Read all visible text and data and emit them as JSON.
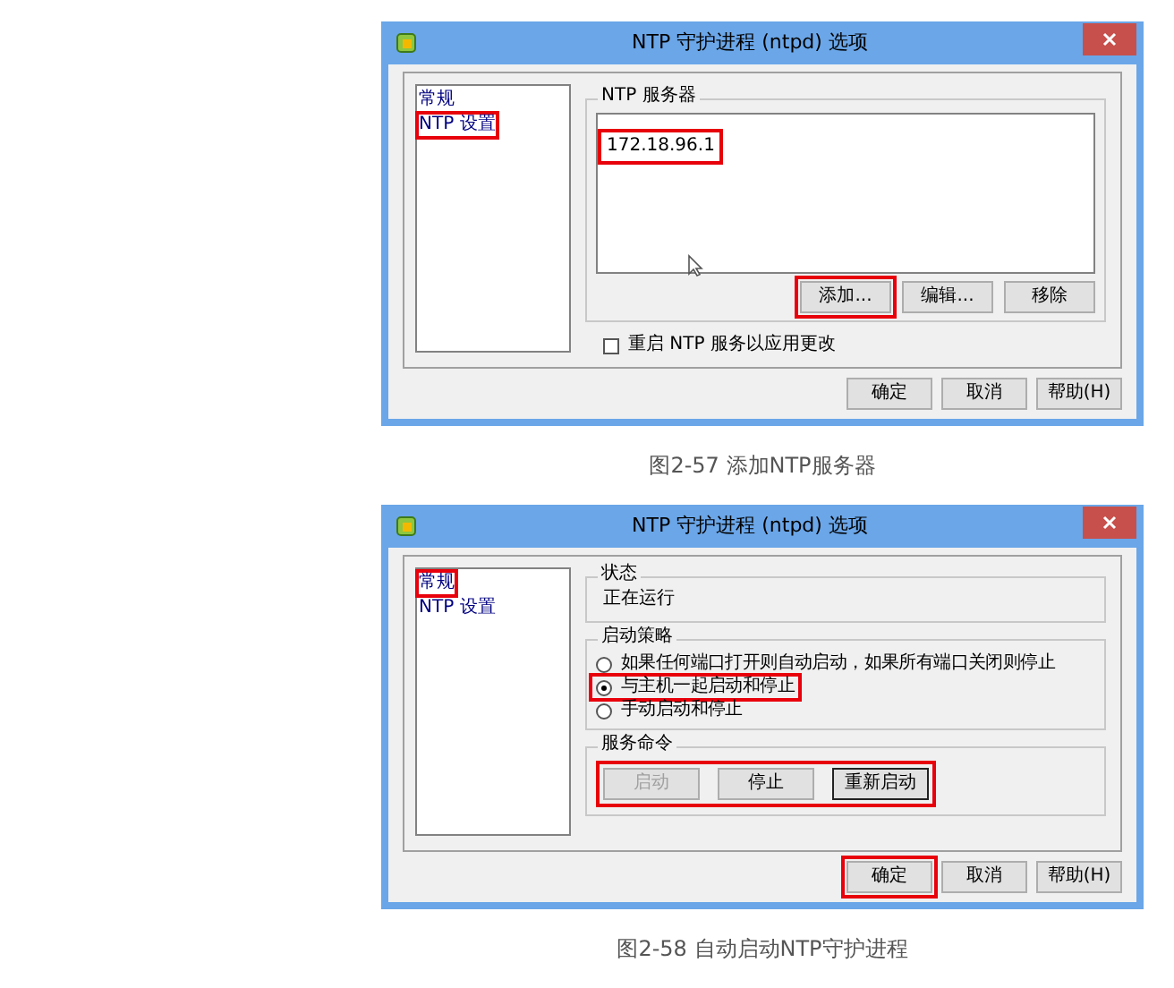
{
  "figures": [
    {
      "dialog": {
        "title": "NTP 守护进程 (ntpd) 选项",
        "sidebar": {
          "items": [
            {
              "label": "常规",
              "highlighted": false
            },
            {
              "label": "NTP 设置",
              "highlighted": true
            }
          ]
        },
        "panel": {
          "kind": "servers",
          "group_title": "NTP 服务器",
          "servers": [
            {
              "address": "172.18.96.1",
              "highlighted": true
            }
          ],
          "buttons": [
            {
              "label": "添加...",
              "highlighted": true
            },
            {
              "label": "编辑...",
              "highlighted": false
            },
            {
              "label": "移除",
              "highlighted": false
            }
          ],
          "checkbox": {
            "label": "重启 NTP 服务以应用更改",
            "checked": false
          }
        },
        "buttons": [
          {
            "label": "确定",
            "highlighted": false
          },
          {
            "label": "取消",
            "highlighted": false
          },
          {
            "label": "帮助(H)",
            "highlighted": false
          }
        ]
      },
      "caption": "图2-57 添加NTP服务器"
    },
    {
      "dialog": {
        "title": "NTP 守护进程 (ntpd) 选项",
        "sidebar": {
          "items": [
            {
              "label": "常规",
              "highlighted": true
            },
            {
              "label": "NTP 设置",
              "highlighted": false
            }
          ]
        },
        "panel": {
          "kind": "general",
          "groups": [
            {
              "kind": "status",
              "title": "状态",
              "text": "正在运行"
            },
            {
              "kind": "radios",
              "title": "启动策略",
              "options": [
                {
                  "label": "如果任何端口打开则自动启动，如果所有端口关闭则停止",
                  "selected": false,
                  "highlighted": false
                },
                {
                  "label": "与主机一起启动和停止",
                  "selected": true,
                  "highlighted": true
                },
                {
                  "label": "手动启动和停止",
                  "selected": false,
                  "highlighted": false
                }
              ]
            },
            {
              "kind": "commands",
              "title": "服务命令",
              "highlighted": true,
              "buttons": [
                {
                  "label": "启动",
                  "disabled": true,
                  "default": false
                },
                {
                  "label": "停止",
                  "disabled": false,
                  "default": false
                },
                {
                  "label": "重新启动",
                  "disabled": false,
                  "default": true
                }
              ]
            }
          ]
        },
        "buttons": [
          {
            "label": "确定",
            "highlighted": true
          },
          {
            "label": "取消",
            "highlighted": false
          },
          {
            "label": "帮助(H)",
            "highlighted": false
          }
        ]
      },
      "caption": "图2-58 自动启动NTP守护进程"
    }
  ]
}
